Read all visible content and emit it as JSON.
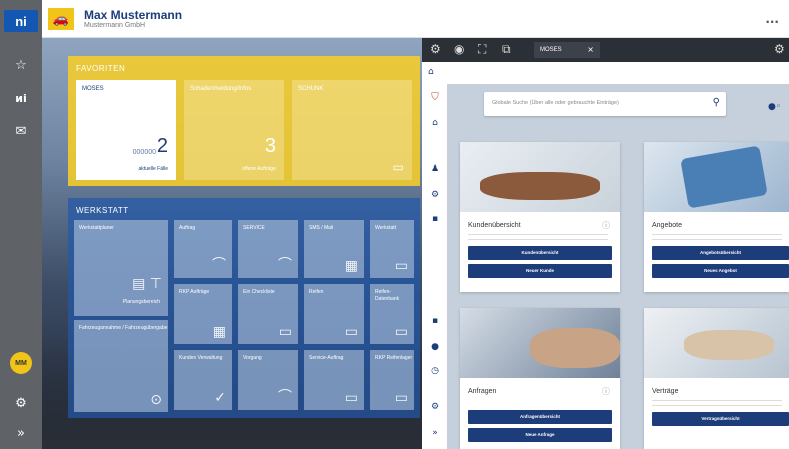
{
  "rail": {
    "logo": "ni",
    "avatar": "MM"
  },
  "topbar": {
    "user_name": "Max Mustermann",
    "company": "Mustermann GmbH",
    "more": "..."
  },
  "favorites": {
    "title": "FAVORITEN",
    "tiles": [
      {
        "title": "MOSES",
        "count": "2",
        "prev": "000000",
        "sub": "aktuelle Fälle"
      },
      {
        "title": "Schadenmeldung/Infos",
        "count": "3",
        "sub": "offene Aufträge"
      },
      {
        "title": "SCHUNK",
        "count": "",
        "sub": ""
      }
    ]
  },
  "werkstatt": {
    "title": "WERKSTATT",
    "tiles": [
      {
        "title": "Werkstattplaner",
        "icon": "▤ ⊤",
        "sub": "Planungsbereich"
      },
      {
        "title": "Fahrzeugannahme / Fahrzeugübergabe",
        "icon": "⊙"
      },
      {
        "title": "Auftrag",
        "icon": "⌒"
      },
      {
        "title": "SERVICE",
        "icon": "⌒"
      },
      {
        "title": "SMS / Mail",
        "icon": "▦"
      },
      {
        "title": "Werkstatt",
        "icon": "▭"
      },
      {
        "title": "RKP Aufträge",
        "icon": "▦"
      },
      {
        "title": "Ein Checkliste",
        "icon": "▭"
      },
      {
        "title": "Reifen",
        "icon": "▭"
      },
      {
        "title": "Reifen-Datenbank",
        "icon": "▭"
      },
      {
        "title": "Kunden Verwaltung",
        "icon": "✓"
      },
      {
        "title": "Vorgang",
        "icon": "⌒"
      },
      {
        "title": "Service-Auftrag",
        "icon": "▭"
      },
      {
        "title": "RKP Reifenlager",
        "icon": "▭"
      }
    ]
  },
  "panel": {
    "tab_label": "MOSES",
    "search_placeholder": "Globale Suche (Über alle oder gebrauchte Einträge)",
    "cards": [
      {
        "title": "Kundenübersicht",
        "buttons": [
          "Kundenübersicht",
          "Neuer Kunde"
        ]
      },
      {
        "title": "Angebote",
        "buttons": [
          "Angebotsübersicht",
          "Neues Angebot"
        ]
      },
      {
        "title": "Anfragen",
        "buttons": [
          "Anfragenübersicht",
          "Neue Anfrage"
        ]
      },
      {
        "title": "Verträge",
        "buttons": [
          "Vertragsübersicht"
        ]
      }
    ]
  }
}
